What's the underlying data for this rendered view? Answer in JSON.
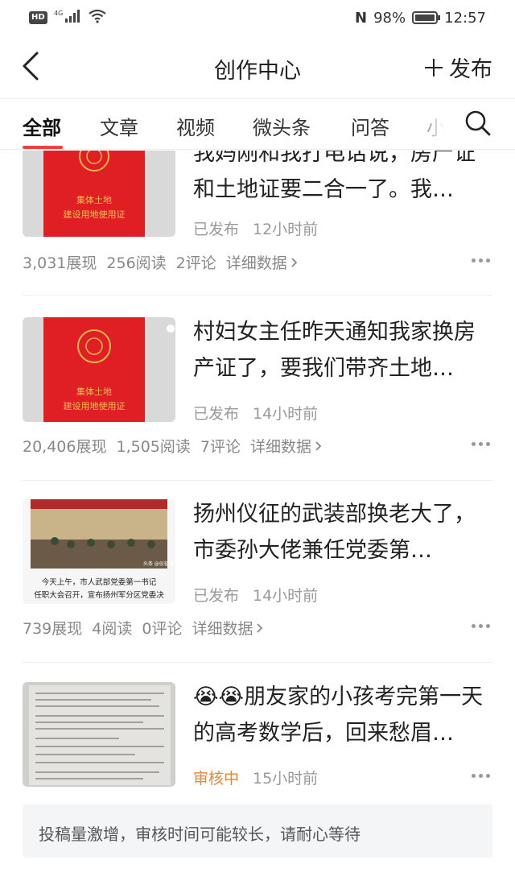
{
  "status_bar": {
    "hd": "HD",
    "network": "4G",
    "battery": "98%",
    "time": "12:57",
    "nfc": "N"
  },
  "header": {
    "title": "创作中心",
    "publish_label": "发布"
  },
  "tabs": [
    {
      "label": "全部",
      "active": true
    },
    {
      "label": "文章",
      "active": false
    },
    {
      "label": "视频",
      "active": false
    },
    {
      "label": "微头条",
      "active": false
    },
    {
      "label": "问答",
      "active": false
    },
    {
      "label": "小",
      "active": false
    }
  ],
  "accent_color": "#f04142",
  "review_color": "#e8862d",
  "posts": [
    {
      "title": "我妈刚和我打电话说，房产证和土地证要二合一了。我…",
      "status": "已发布",
      "time": "12小时前",
      "stats": {
        "impressions": "3,031展现",
        "reads": "256阅读",
        "comments": "2评论",
        "detail": "详细数据"
      },
      "thumb": "red-certificate",
      "thumb_text": [
        "集体土地",
        "建设用地使用证"
      ]
    },
    {
      "title": "村妇女主任昨天通知我家换房产证了，要我们带齐土地…",
      "status": "已发布",
      "time": "14小时前",
      "stats": {
        "impressions": "20,406展现",
        "reads": "1,505阅读",
        "comments": "7评论",
        "detail": "详细数据"
      },
      "thumb": "red-certificate",
      "thumb_text": [
        "集体土地",
        "建设用地使用证"
      ]
    },
    {
      "title": "扬州仪征的武装部换老大了，市委孙大佬兼任党委第…",
      "status": "已发布",
      "time": "14小时前",
      "stats": {
        "impressions": "739展现",
        "reads": "4阅读",
        "comments": "0评论",
        "detail": "详细数据"
      },
      "thumb": "meeting-photo",
      "thumb_text": [
        "今天上午，市人武部党委第一书记",
        "任职大会召开，宣布扬州军分区党委决",
        "头条 @仪征发布"
      ]
    },
    {
      "title": "😭😭朋友家的小孩考完第一天的高考数学后，回来愁眉…",
      "status": "审核中",
      "time": "15小时前",
      "thumb": "exam-paper"
    }
  ],
  "notice": "投稿量激增，审核时间可能较长，请耐心等待"
}
